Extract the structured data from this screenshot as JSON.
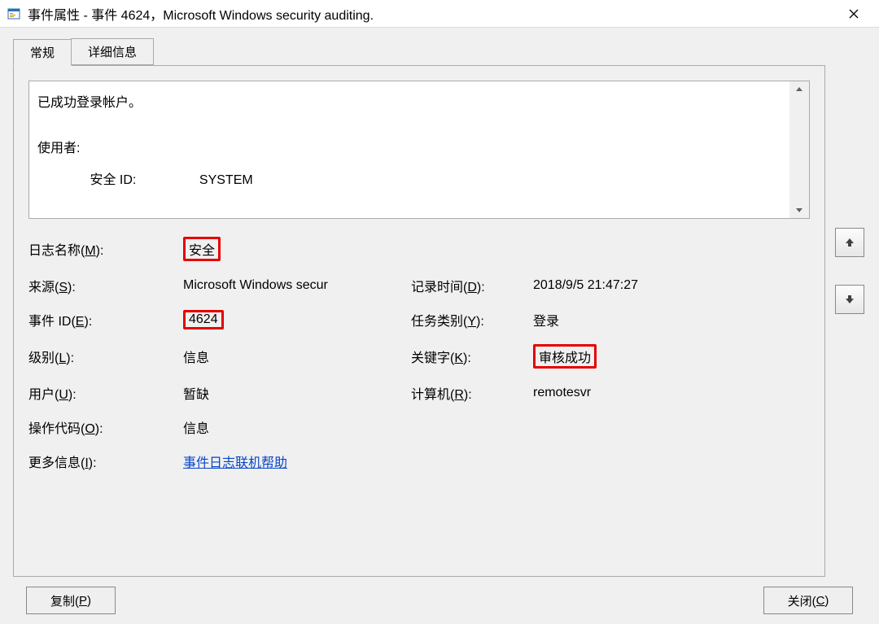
{
  "title": "事件属性 - 事件 4624，Microsoft Windows security auditing.",
  "tabs": {
    "general": "常规",
    "details": "详细信息"
  },
  "desc": {
    "line1": "已成功登录帐户。",
    "subject_label": "使用者:",
    "sid_label": "安全 ID:",
    "sid_value": "SYSTEM"
  },
  "fields": {
    "logname_label": "日志名称(",
    "logname_key": "M",
    "logname_value": "安全",
    "source_label": "来源(",
    "source_key": "S",
    "source_value": "Microsoft Windows secur",
    "logged_label": "记录时间(",
    "logged_key": "D",
    "logged_value": "2018/9/5 21:47:27",
    "eventid_label": "事件 ID(",
    "eventid_key": "E",
    "eventid_value": "4624",
    "task_label": "任务类别(",
    "task_key": "Y",
    "task_value": "登录",
    "level_label": "级别(",
    "level_key": "L",
    "level_value": "信息",
    "keywords_label": "关键字(",
    "keywords_key": "K",
    "keywords_value": "审核成功",
    "user_label": "用户(",
    "user_key": "U",
    "user_value": "暂缺",
    "computer_label": "计算机(",
    "computer_key": "R",
    "computer_value": "remotesvr",
    "opcode_label": "操作代码(",
    "opcode_key": "O",
    "opcode_value": "信息",
    "moreinfo_label": "更多信息(",
    "moreinfo_key": "I",
    "moreinfo_link": "事件日志联机帮助",
    "label_close": "):"
  },
  "buttons": {
    "copy": "复制(",
    "copy_key": "P",
    "close": "关闭(",
    "close_key": "C",
    "paren_close": ")"
  }
}
